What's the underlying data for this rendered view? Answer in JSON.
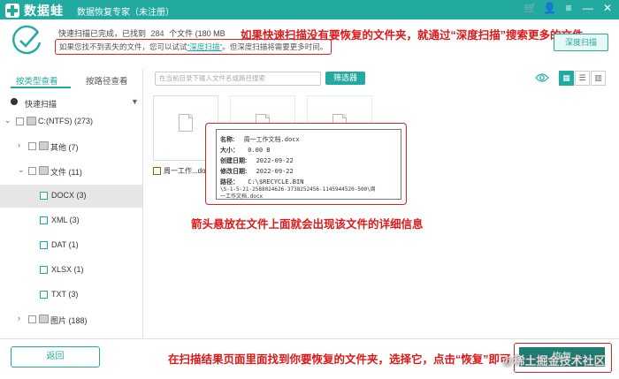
{
  "titlebar": {
    "logo_text": "数据蛙",
    "subtitle": "数据恢复专家（未注册）",
    "icons": [
      "cart-icon",
      "user-icon",
      "menu-icon",
      "minimize-icon",
      "close-icon"
    ],
    "icon_glyphs": [
      "🛒",
      "👤",
      "≡",
      "—",
      "✕"
    ]
  },
  "status": {
    "line_prefix": "快速扫描已完成，已找到",
    "count": "284",
    "line_middle": "个文件 (",
    "size": "180 MB",
    "hint_prefix": "如果您找不到丢失的文件，您可以试试",
    "hint_link": "“深度扫描”",
    "hint_suffix": "。但深度扫描将需要更多时间。",
    "deep_scan_button": "深度扫描"
  },
  "annotations": {
    "top": "如果快速扫描没有要恢复的文件夹，就通过“深度扫描”搜索更多的文件",
    "middle": "箭头悬放在文件上面就会出现该文件的详细信息",
    "bottom": "在扫描结果页面里面找到你要恢复的文件夹，选择它，点击“恢复”即可"
  },
  "left_panel": {
    "tab_type": "按类型查看",
    "tab_path": "按路径查看",
    "scan_mode": "快速扫描",
    "tree": [
      {
        "label": "C:(NTFS) (273)"
      },
      {
        "label": "其他 (7)"
      },
      {
        "label": "文件 (11)"
      },
      {
        "label": "DOCX (3)"
      },
      {
        "label": "XML (3)"
      },
      {
        "label": "DAT (1)"
      },
      {
        "label": "XLSX (1)"
      },
      {
        "label": "TXT (3)"
      },
      {
        "label": "图片 (188)"
      }
    ]
  },
  "right_panel": {
    "search_placeholder": "在当前目录下输入文件名或路径搜索",
    "filter_button": "筛选器",
    "file_name": "周一工作...docx"
  },
  "tooltip": {
    "name_label": "名称:",
    "name_value": "周一工作文档.docx",
    "size_label": "大小：",
    "size_value": "0.00 B",
    "created_label": "创建日期:",
    "created_value": "2022-09-22",
    "modified_label": "修改日期:",
    "modified_value": "2022-09-22",
    "path_label": "路径：",
    "path_line1": "C:\\$RECYCLE.BIN",
    "path_line2": "\\S-1-5-21-2588024626-3738252456-1145944520-500\\周",
    "path_line3": "一工作文档.docx"
  },
  "bottom": {
    "back_button": "返回",
    "recover_button": "恢复",
    "watermark": "@稀土掘金技术社区"
  }
}
